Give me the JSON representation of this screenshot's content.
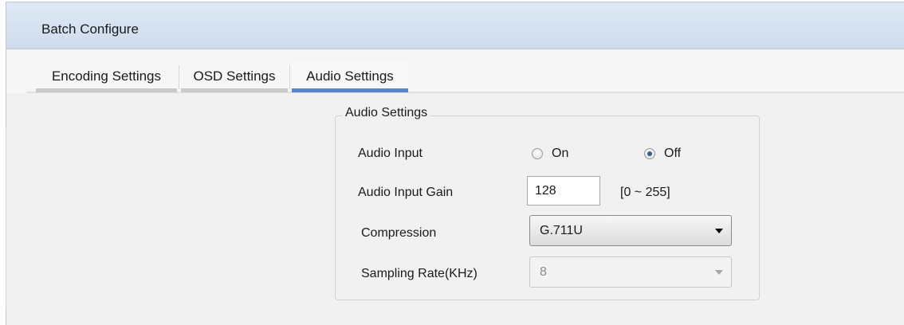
{
  "window": {
    "title": "Batch Configure"
  },
  "tabs": [
    {
      "label": "Encoding Settings",
      "active": false
    },
    {
      "label": "OSD Settings",
      "active": false
    },
    {
      "label": "Audio Settings",
      "active": true
    }
  ],
  "audio_group": {
    "legend": "Audio Settings",
    "audio_input": {
      "label": "Audio Input",
      "options": [
        {
          "label": "On",
          "selected": false
        },
        {
          "label": "Off",
          "selected": true
        }
      ]
    },
    "audio_input_gain": {
      "label": "Audio Input Gain",
      "value": "128",
      "range": "[0 ~ 255]"
    },
    "compression": {
      "label": "Compression",
      "selected": "G.711U"
    },
    "sampling_rate": {
      "label": "Sampling Rate(KHz)",
      "selected": "8",
      "disabled": true
    }
  },
  "colors": {
    "active_tab_accent": "#4e88d6",
    "titlebar": "#d8e4f1",
    "panel_background": "#f1f1f1"
  }
}
